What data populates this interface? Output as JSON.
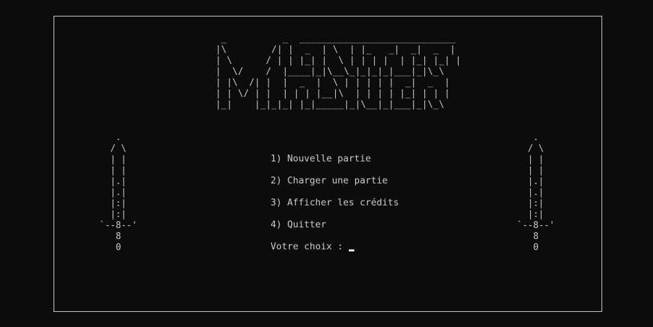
{
  "logo": {
    "ascii": " _          _  ____________________________\n|\\        /| |  _  | \\  | |_   _|  _|  _  |\n| \\      / | | |_| |  \\ | | | |  | |_| |_| |\n|  \\/    /  |____|_|\\__\\_|_|_|_|___|_|\\_\\\n| |\\  /| |  |  _  |  \\ | | | | |  _|  _  |\n| | \\/ | |  | | | |__|\\  | | | | |_| | | |\n|_|    |_|_|_| |_|_____|_|\\__|_|___|_|\\_\\"
  },
  "swords": {
    "left": "   .\n  / \\\n  | |\n  | |\n  |.|\n  |.|\n  |:|\n  |:|\n`--8--'\n   8\n   0",
    "right": "   .\n  / \\\n  | |\n  | |\n  |.|\n  |.|\n  |:|\n  |:|\n`--8--'\n   8\n   0"
  },
  "menu": {
    "items": [
      "1) Nouvelle partie",
      "2) Charger une partie",
      "3) Afficher les crédits",
      "4) Quitter"
    ],
    "prompt": "Votre choix : "
  },
  "colors": {
    "background": "#0c0c0c",
    "text": "#cccccc",
    "border": "#cfcfcf"
  }
}
